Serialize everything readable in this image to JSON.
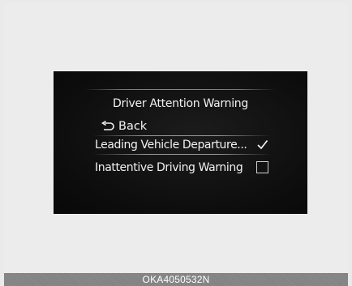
{
  "menu": {
    "title": "Driver Attention Warning",
    "back_label": "Back",
    "items": [
      {
        "label": "Leading Vehicle Departure...",
        "checked": true
      },
      {
        "label": "Inattentive Driving Warning",
        "checked": false
      }
    ]
  },
  "caption": "OKA4050532N",
  "icons": {
    "back": "back-arrow-icon",
    "checked": "checkmark-icon",
    "unchecked": "empty-checkbox-icon"
  }
}
